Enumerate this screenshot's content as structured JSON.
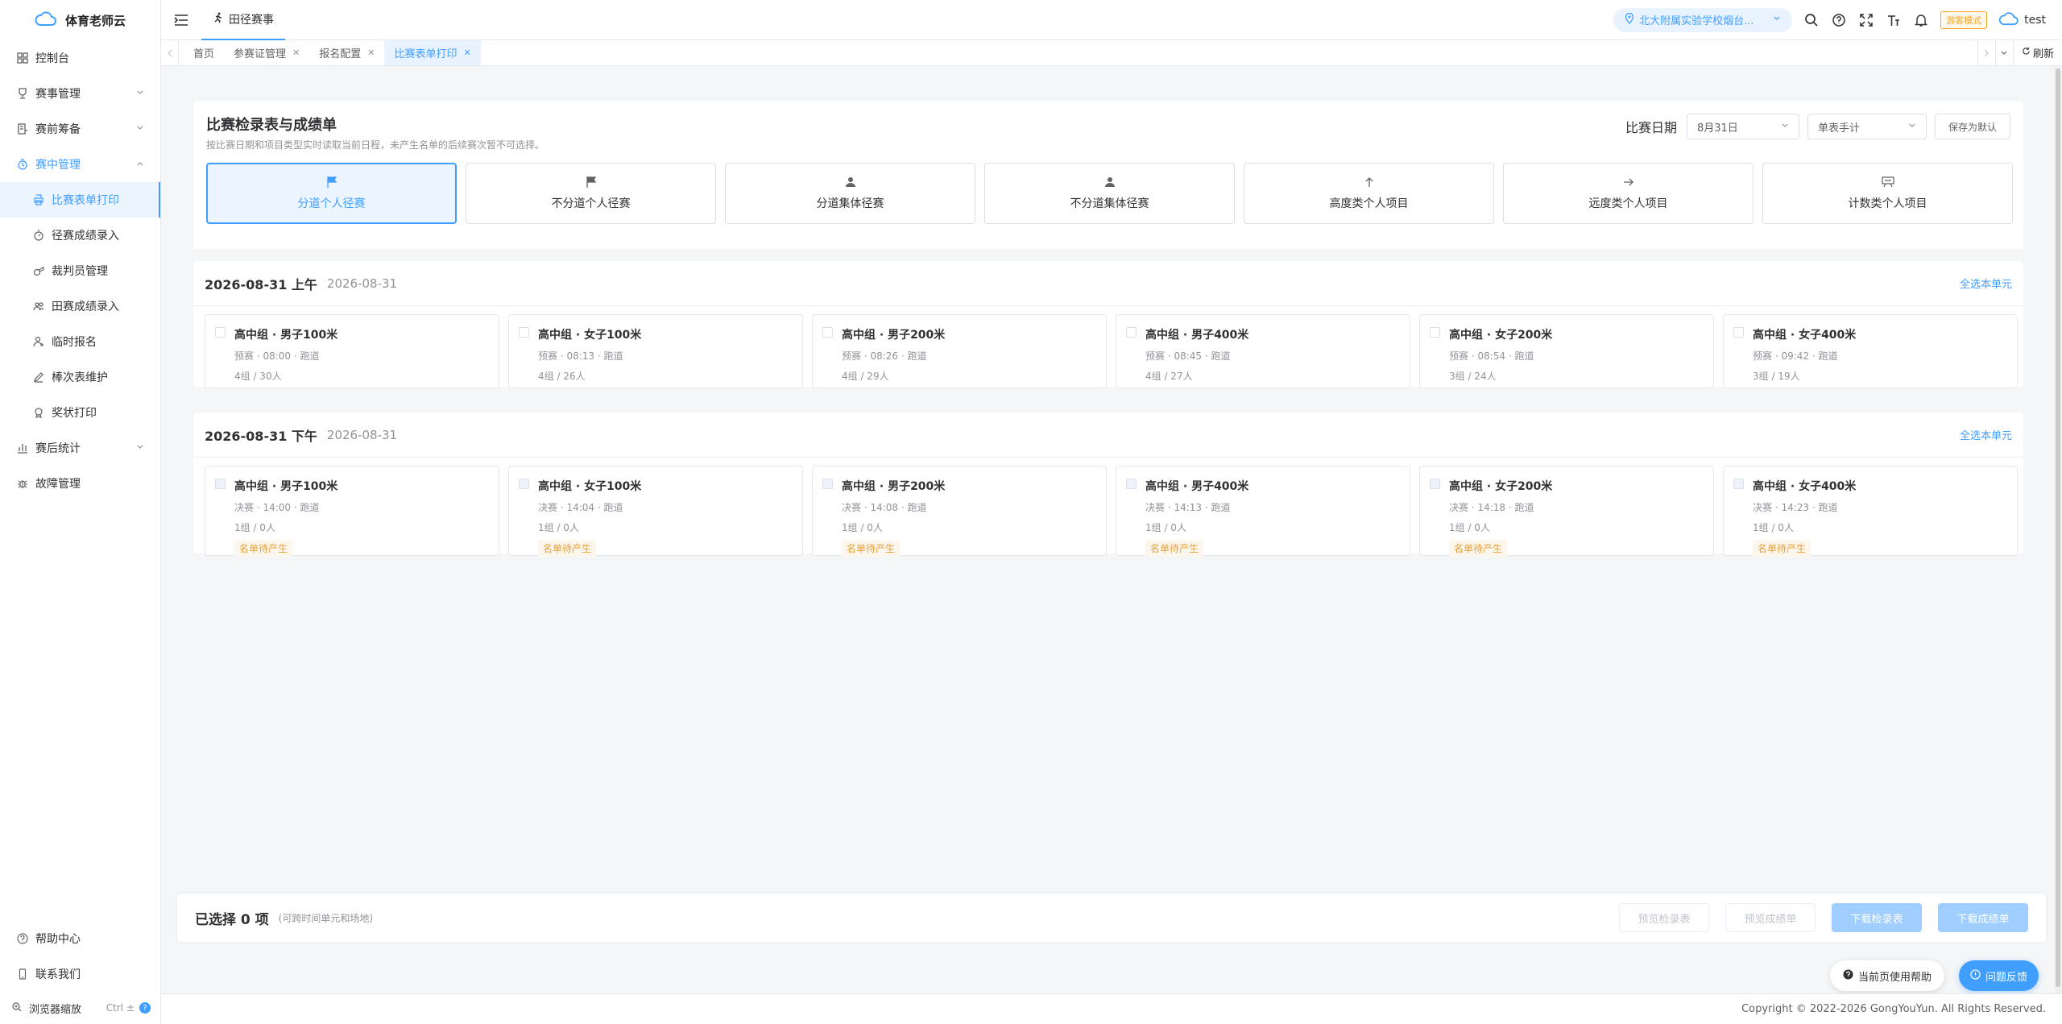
{
  "app": {
    "name": "体育老师云"
  },
  "sidebar": {
    "items": [
      {
        "label": "控制台",
        "icon": "dashboard-icon"
      },
      {
        "label": "赛事管理",
        "icon": "trophy-icon",
        "expandable": true
      },
      {
        "label": "赛前筹备",
        "icon": "clipboard-icon",
        "expandable": true
      },
      {
        "label": "赛中管理",
        "icon": "timer-icon",
        "expandable": true,
        "expanded": true
      }
    ],
    "sub_items": [
      {
        "label": "比赛表单打印",
        "active": true
      },
      {
        "label": "径赛成绩录入"
      },
      {
        "label": "裁判员管理"
      },
      {
        "label": "田赛成绩录入"
      },
      {
        "label": "临时报名"
      },
      {
        "label": "棒次表维护"
      },
      {
        "label": "奖状打印"
      }
    ],
    "after_items": [
      {
        "label": "赛后统计",
        "icon": "stats-icon",
        "expandable": true
      },
      {
        "label": "故障管理",
        "icon": "bug-icon"
      }
    ],
    "bottom": {
      "help": "帮助中心",
      "contact": "联系我们",
      "zoom": "浏览器缩放",
      "zoom_hint": "Ctrl ±"
    }
  },
  "header": {
    "tab": "田径赛事",
    "school": "北大附属实验学校烟台...",
    "mode": "游客模式",
    "user": "test"
  },
  "tags": [
    {
      "label": "首页",
      "closable": false
    },
    {
      "label": "参赛证管理",
      "closable": true
    },
    {
      "label": "报名配置",
      "closable": true
    },
    {
      "label": "比赛表单打印",
      "closable": true,
      "active": true
    }
  ],
  "refresh_label": "刷新",
  "top_card": {
    "title": "比赛检录表与成绩单",
    "subtitle": "按比赛日期和项目类型实时读取当前日程，未产生名单的后续赛次暂不可选择。",
    "date_label": "比赛日期",
    "date_value": "8月31日",
    "timing_value": "单表手计",
    "save_default": "保存为默认",
    "types": [
      {
        "label": "分道个人径赛",
        "icon": "flag-icon",
        "active": true
      },
      {
        "label": "不分道个人径赛",
        "icon": "flag-icon"
      },
      {
        "label": "分道集体径赛",
        "icon": "person-icon"
      },
      {
        "label": "不分道集体径赛",
        "icon": "person-icon"
      },
      {
        "label": "高度类个人项目",
        "icon": "arrow-up-icon"
      },
      {
        "label": "远度类个人项目",
        "icon": "arrow-right-icon"
      },
      {
        "label": "计数类个人项目",
        "icon": "counter-icon"
      }
    ]
  },
  "sessions": [
    {
      "title": "2026-08-31 上午",
      "date": "2026-08-31",
      "select_all": "全选本单元",
      "events": [
        {
          "name": "高中组 · 男子100米",
          "info": "预赛 · 08:00 · 跑道",
          "count": "4组 / 30人"
        },
        {
          "name": "高中组 · 女子100米",
          "info": "预赛 · 08:13 · 跑道",
          "count": "4组 / 26人"
        },
        {
          "name": "高中组 · 男子200米",
          "info": "预赛 · 08:26 · 跑道",
          "count": "4组 / 29人"
        },
        {
          "name": "高中组 · 男子400米",
          "info": "预赛 · 08:45 · 跑道",
          "count": "4组 / 27人"
        },
        {
          "name": "高中组 · 女子200米",
          "info": "预赛 · 08:54 · 跑道",
          "count": "3组 / 24人"
        },
        {
          "name": "高中组 · 女子400米",
          "info": "预赛 · 09:42 · 跑道",
          "count": "3组 / 19人"
        }
      ]
    },
    {
      "title": "2026-08-31 下午",
      "date": "2026-08-31",
      "select_all": "全选本单元",
      "events": [
        {
          "name": "高中组 · 男子100米",
          "info": "决赛 · 14:00 · 跑道",
          "count": "1组 / 0人",
          "badge": "名单待产生"
        },
        {
          "name": "高中组 · 女子100米",
          "info": "决赛 · 14:04 · 跑道",
          "count": "1组 / 0人",
          "badge": "名单待产生"
        },
        {
          "name": "高中组 · 男子200米",
          "info": "决赛 · 14:08 · 跑道",
          "count": "1组 / 0人",
          "badge": "名单待产生"
        },
        {
          "name": "高中组 · 男子400米",
          "info": "决赛 · 14:13 · 跑道",
          "count": "1组 / 0人",
          "badge": "名单待产生"
        },
        {
          "name": "高中组 · 女子200米",
          "info": "决赛 · 14:18 · 跑道",
          "count": "1组 / 0人",
          "badge": "名单待产生"
        },
        {
          "name": "高中组 · 女子400米",
          "info": "决赛 · 14:23 · 跑道",
          "count": "1组 / 0人",
          "badge": "名单待产生"
        }
      ]
    }
  ],
  "bottom_bar": {
    "selected": "已选择 0 项",
    "hint": "(可跨时间单元和场地)",
    "preview_check": "预览检录表",
    "preview_result": "预览成绩单",
    "download_check": "下载检录表",
    "download_result": "下载成绩单"
  },
  "floating": {
    "help": "当前页使用帮助",
    "feedback": "问题反馈"
  },
  "footer": "Copyright © 2022-2026 GongYouYun. All Rights Reserved.",
  "colors": {
    "primary": "#409eff",
    "warning": "#e6a23c",
    "mode_badge": "#f5a623"
  }
}
